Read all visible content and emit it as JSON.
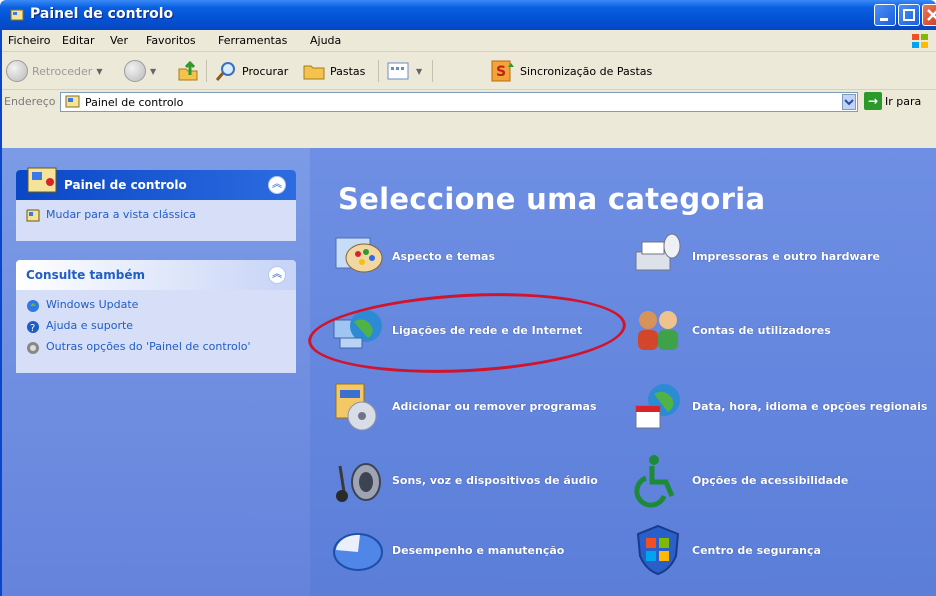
{
  "window": {
    "title": "Painel de controlo"
  },
  "menu": [
    "Ficheiro",
    "Editar",
    "Ver",
    "Favoritos",
    "Ferramentas",
    "Ajuda"
  ],
  "toolbar": {
    "back_label": "Retroceder",
    "search_label": "Procurar",
    "folders_label": "Pastas",
    "sync_label": "Sincronização de Pastas"
  },
  "address": {
    "label": "Endereço",
    "value": "Painel de controlo",
    "go_label": "Ir para"
  },
  "left_panel": {
    "panel1_title": "Painel de controlo",
    "panel1_link": "Mudar para a vista clássica",
    "panel2_title": "Consulte também",
    "panel2_links": [
      "Windows Update",
      "Ajuda e suporte",
      "Outras opções do 'Painel de controlo'"
    ]
  },
  "main": {
    "heading": "Seleccione uma categoria",
    "categories": [
      "Aspecto e temas",
      "Impressoras e outro hardware",
      "Ligações de rede e de Internet",
      "Contas de utilizadores",
      "Adicionar ou remover programas",
      "Data, hora, idioma e opções regionais",
      "Sons, voz e dispositivos de áudio",
      "Opções de acessibilidade",
      "Desempenho e manutenção",
      "Centro de segurança"
    ]
  },
  "colors": {
    "title_blue": "#0a5fe0",
    "pane_blue": "#6e8fe3",
    "link_blue": "#215dc6",
    "highlight_red": "#d1132b"
  }
}
